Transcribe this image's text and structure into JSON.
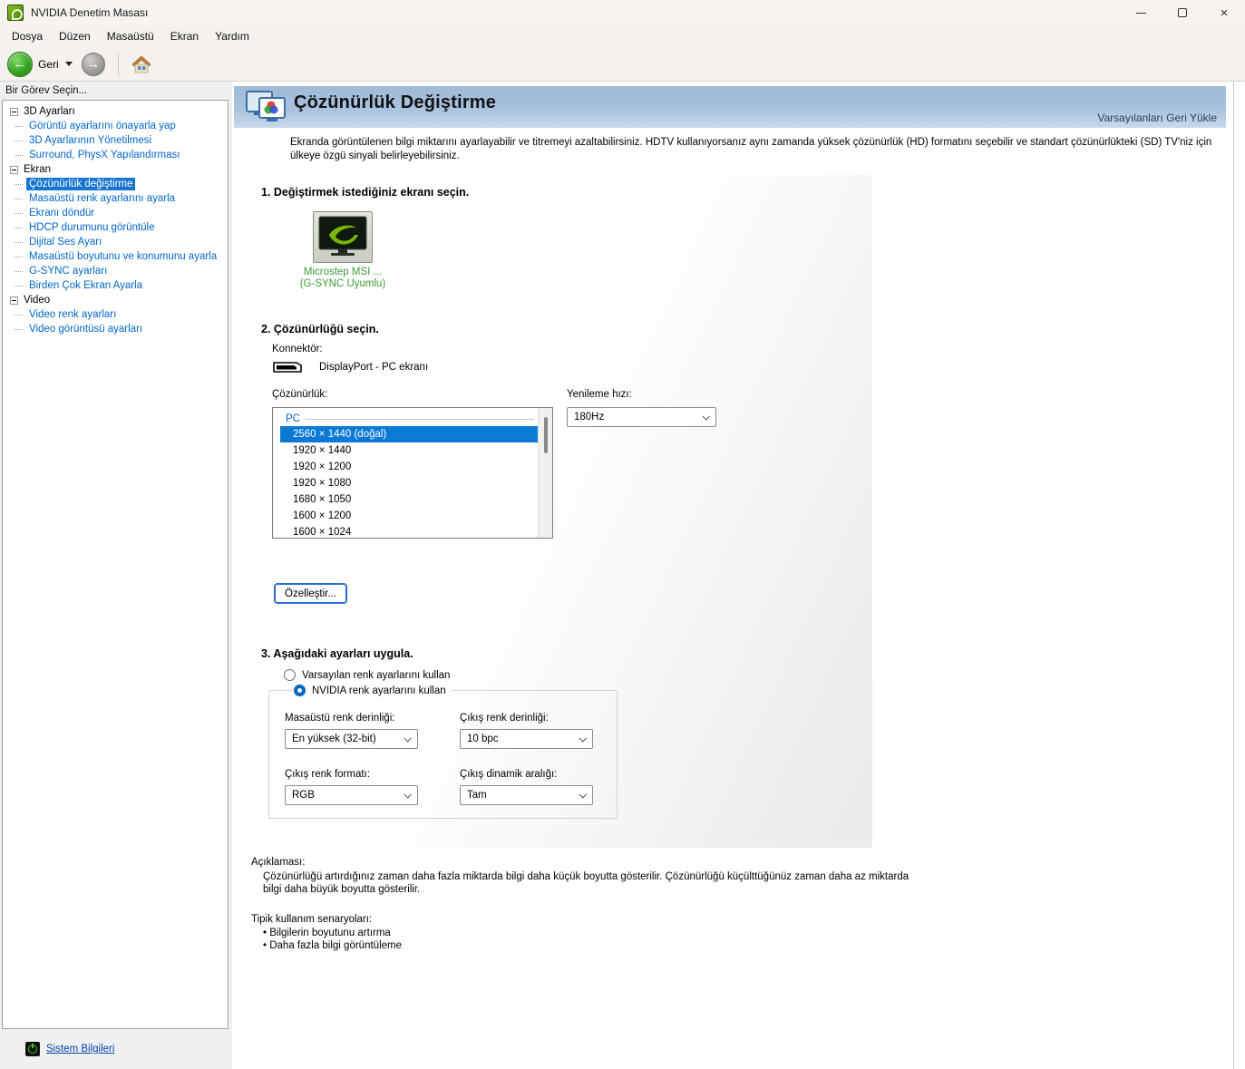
{
  "window": {
    "title": "NVIDIA Denetim Masası"
  },
  "menu": {
    "items": [
      "Dosya",
      "Düzen",
      "Masaüstü",
      "Ekran",
      "Yardım"
    ]
  },
  "toolbar": {
    "back_label": "Geri"
  },
  "icons": {
    "app": "nvidia-logo",
    "back": "green-back-arrow-circle",
    "forward": "gray-forward-arrow-circle",
    "home": "home-house",
    "banner": "dual-monitor-rgb",
    "display": "monitor-nvidia-logo",
    "connector": "displayport-plug",
    "system_info": "green-info-power",
    "window_controls": [
      "minimize",
      "maximize",
      "close"
    ]
  },
  "sidebar": {
    "header": "Bir Görev Seçin...",
    "groups": [
      {
        "label": "3D Ayarları",
        "children": [
          "Görüntü ayarlarını önayarla yap",
          "3D Ayarlarının Yönetilmesi",
          "Surround, PhysX Yapılandırması"
        ]
      },
      {
        "label": "Ekran",
        "children": [
          "Çözünürlük değiştirme",
          "Masaüstü renk ayarlarını ayarla",
          "Ekranı döndür",
          "HDCP durumunu görüntüle",
          "Dijital Ses Ayarı",
          "Masaüstü boyutunu ve konumunu ayarla",
          "G-SYNC ayarları",
          "Birden Çok Ekran Ayarla"
        ]
      },
      {
        "label": "Video",
        "children": [
          "Video renk ayarları",
          "Video görüntüsü ayarları"
        ]
      }
    ],
    "selected_item": "Çözünürlük değiştirme",
    "system_info": "Sistem Bilgileri"
  },
  "header": {
    "title": "Çözünürlük Değiştirme",
    "restore_defaults": "Varsayılanları Geri Yükle"
  },
  "intro": "Ekranda görüntülenen bilgi miktarını ayarlayabilir ve titremeyi azaltabilirsiniz. HDTV kullanıyorsanız aynı zamanda yüksek çözünürlük (HD) formatını seçebilir ve standart çözünürlükteki (SD) TV'niz için ülkeye özgü sinyali belirleyebilirsiniz.",
  "step1": {
    "heading": "1. Değiştirmek istediğiniz ekranı seçin.",
    "display_name": "Microstep MSI ...",
    "display_tag": "(G-SYNC Uyumlu)"
  },
  "step2": {
    "heading": "2. Çözünürlüğü seçin.",
    "connector_label": "Konnektör:",
    "connector_value": "DisplayPort - PC ekranı",
    "resolution_label": "Çözünürlük:",
    "group_label": "PC",
    "resolutions": [
      "2560 × 1440 (doğal)",
      "1920 × 1440",
      "1920 × 1200",
      "1920 × 1080",
      "1680 × 1050",
      "1600 × 1200",
      "1600 × 1024"
    ],
    "selected_index": 0,
    "refresh_label": "Yenileme hızı:",
    "refresh_value": "180Hz",
    "customize_button": "Özelleştir..."
  },
  "step3": {
    "heading": "3. Aşağıdaki ayarları uygula.",
    "radio_default": "Varsayılan renk ayarlarını kullan",
    "radio_nvidia": "NVIDIA renk ayarlarını kullan",
    "desktop_depth_label": "Masaüstü renk derinliği:",
    "desktop_depth_value": "En yüksek (32-bit)",
    "output_depth_label": "Çıkış renk derinliği:",
    "output_depth_value": "10 bpc",
    "output_format_label": "Çıkış renk formatı:",
    "output_format_value": "RGB",
    "output_range_label": "Çıkış dinamik aralığı:",
    "output_range_value": "Tam"
  },
  "info": {
    "desc_label": "Açıklaması:",
    "desc_text": "Çözünürlüğü artırdığınız zaman daha fazla miktarda bilgi daha küçük boyutta gösterilir. Çözünürlüğü küçülttüğünüz zaman daha az miktarda bilgi daha büyük boyutta gösterilir.",
    "usage_label": "Tipik kullanım senaryoları:",
    "usage_items": [
      "Bilgilerin boyutunu artırma",
      "Daha fazla bilgi görüntüleme"
    ]
  },
  "colors": {
    "accent": "#0078d7",
    "tree_link": "#0066cc",
    "nvidia_green": "#76b900",
    "banner_top": "#9fb9d8",
    "banner_bottom": "#c9d9ec",
    "display_caption_green": "#3d9b35"
  }
}
